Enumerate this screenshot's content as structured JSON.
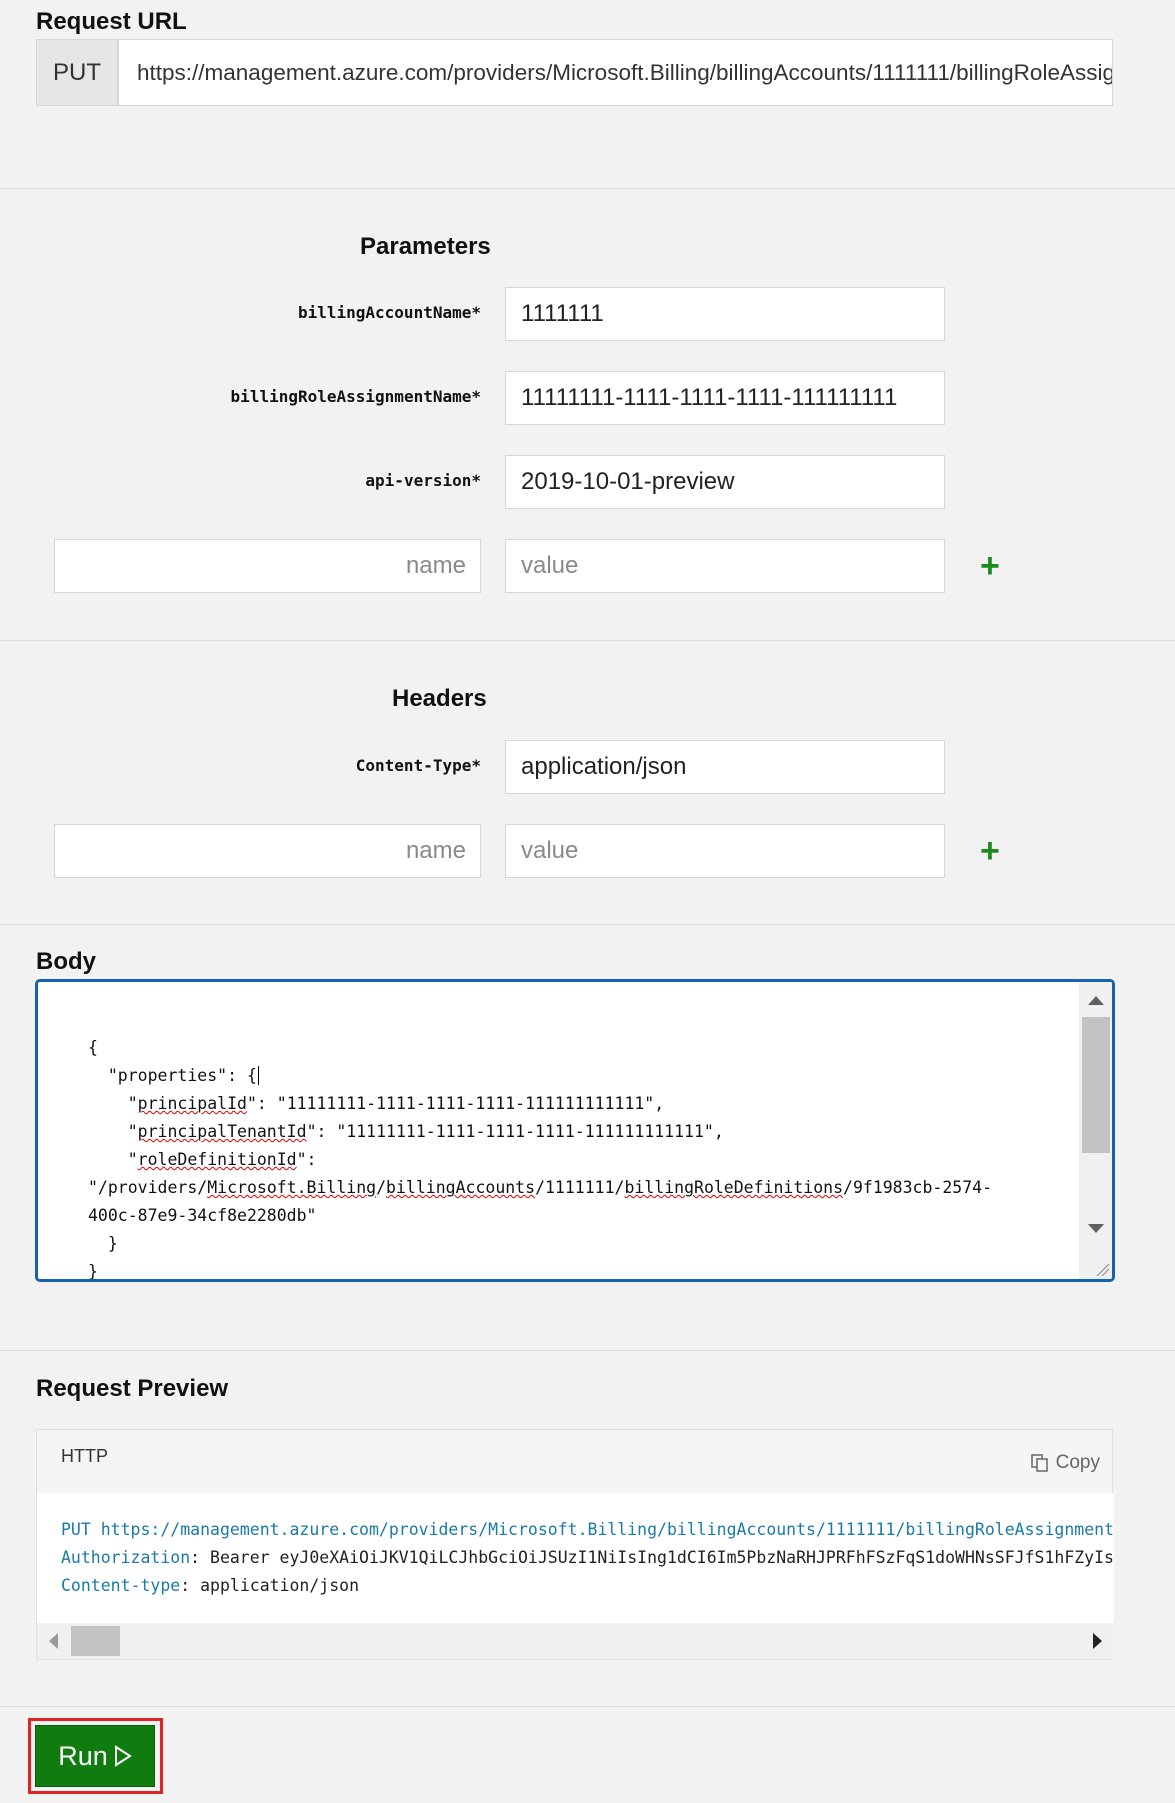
{
  "request_url": {
    "title": "Request URL",
    "method": "PUT",
    "url": "https://management.azure.com/providers/Microsoft.Billing/billingAccounts/1111111/billingRoleAssig"
  },
  "parameters": {
    "title": "Parameters",
    "rows": [
      {
        "label": "billingAccountName*",
        "value": "1111111"
      },
      {
        "label": "billingRoleAssignmentName*",
        "value": "11111111-1111-1111-1111-111111111"
      },
      {
        "label": "api-version*",
        "value": "2019-10-01-preview"
      }
    ],
    "new_name_placeholder": "name",
    "new_value_placeholder": "value"
  },
  "headers": {
    "title": "Headers",
    "rows": [
      {
        "label": "Content-Type*",
        "value": "application/json"
      }
    ],
    "new_name_placeholder": "name",
    "new_value_placeholder": "value"
  },
  "body": {
    "title": "Body",
    "lines": [
      "{",
      "  \"properties\": {",
      "    \"principalId\": \"11111111-1111-1111-1111-111111111111\",",
      "    \"principalTenantId\": \"11111111-1111-1111-1111-111111111111\",",
      "    \"roleDefinitionId\":",
      "\"/providers/Microsoft.Billing/billingAccounts/1111111/billingRoleDefinitions/9f1983cb-2574-",
      "400c-87e9-34cf8e2280db\"",
      "  }",
      "}"
    ]
  },
  "preview": {
    "title": "Request Preview",
    "tab": "HTTP",
    "copy_label": "Copy",
    "line1_method": "PUT",
    "line1_url": "https://management.azure.com/providers/Microsoft.Billing/billingAccounts/1111111/billingRoleAssignment",
    "line2_key": "Authorization",
    "line2_value": ": Bearer eyJ0eXAiOiJKV1QiLCJhbGciOiJSUzI1NiIsIng1dCI6Im5PbzNaRHJPRFhFSzFqS1doWHNsSFJfS1hFZyIs",
    "line3_key": "Content-type",
    "line3_value": ": application/json"
  },
  "run": {
    "label": "Run"
  },
  "colors": {
    "accent_green": "#107c10",
    "focus_blue": "#1563b0",
    "highlight_red": "#e02424",
    "code_blue": "#1b7aa8"
  }
}
